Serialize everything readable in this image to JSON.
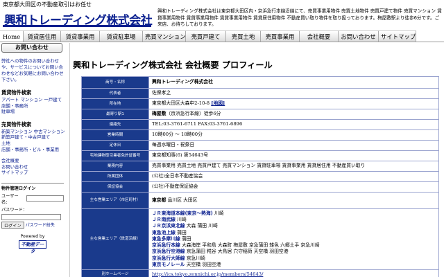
{
  "header": {
    "tagline": "東京都大田区の不動産取引はお任せ",
    "company_name": "興和トレーディング株式会社",
    "intro": "興和トレーディング株式会社は東京都大田区内・京浜急行本線沿線にて、売買事業用物件 売買土地物件 売買戸建て物件 売買マンション 賃貸事業用物件 賃貸事業用物件 賃貸事業用物件 賃貸居住用物件 不動産買い取り物件を取り扱っております。梅屋敷駅より徒歩6分です。ご来店、お待ちしております。"
  },
  "nav": {
    "items": [
      "Home",
      "賃貸居住用",
      "賃貸事業用",
      "賃貸駐車場",
      "売買マンション",
      "売買戸建て",
      "売買土地",
      "売買事業用",
      "会社概要",
      "お問い合わせ",
      "サイトマップ"
    ]
  },
  "sidebar": {
    "contact_title": "お問い合わせ",
    "contact_text": "弊社への物件のお問い合わせや、サービスについてお問い合わせなどお気軽にお問い合わせ下さい。",
    "rental_title": "賃貸物件検索",
    "rental_links": [
      "アパート マンション 一戸建て",
      "店舗・事務所",
      "駐車場"
    ],
    "sale_title": "売買物件検索",
    "sale_links": [
      "新築マンション 中古マンション",
      "新築戸建て・中古戸建て",
      "土地",
      "店舗・事務所・ビル・事業用"
    ],
    "misc_links": [
      "会社概要",
      "お問い合わせ",
      "サイトマップ"
    ],
    "login": {
      "title": "物件管理ログイン",
      "user_label": "ユーザー名：",
      "password_label": "パスワード：",
      "button": "ログイン",
      "forgot": "パスワード紛失"
    },
    "powered_by": "Powered by",
    "powered_logo": "不動産データ"
  },
  "main": {
    "title": "興和トレーディング株式会社 会社概要 プロフィール",
    "rows": {
      "name_label": "商号・名称",
      "name_value": "興和トレーディング株式会社",
      "rep_label": "代表者",
      "rep_value": "佐保孝之",
      "address_label": "所在地",
      "address_value": "東京都大田区大森中2-10-8",
      "address_map": "[地図]",
      "station_label": "最寄り駅1",
      "station_name": "梅屋敷",
      "station_rest": "（京浜急行本線）徒歩6分",
      "contact_label": "連絡先",
      "contact_value": "TEL:03-3761-6711 FAX:03-3761-6896",
      "hours_label": "営業時間",
      "hours_value": "10時00分 ～ 18時00分",
      "holiday_label": "定休日",
      "holiday_value": "毎週水曜日・祝祭日",
      "license_label": "宅地建物取引業者免許証番号",
      "license_value": "東京都知事(6) 第54643号",
      "business_label": "業務内容",
      "business_value": "売買事業用 売買土地 売買戸建て 売買マンション 賃貸駐車場 賃貸事業用 賃貸居住用 不動産買い取り",
      "assoc_label": "所属団体",
      "assoc_value": "(公社)全日本不動産協会",
      "guarantee_label": "保証協会",
      "guarantee_value": "(公社)不動産保証協会",
      "area_label": "主な営業エリア（市区町村）",
      "area_pref": "東京都",
      "area_value": "品川区 大田区",
      "lines_label": "主な営業エリア（鉄道沿線）",
      "lines": [
        {
          "line": "ＪＲ東海道本線(東京～熱海)",
          "stations": "川崎"
        },
        {
          "line": "ＪＲ南武線",
          "stations": "川崎"
        },
        {
          "line": "ＪＲ京浜東北線",
          "stations": "大森 蒲田 川崎"
        },
        {
          "line": "東急池上線",
          "stations": "蒲田"
        },
        {
          "line": "東急多摩川線",
          "stations": "蒲田"
        },
        {
          "line": "京浜急行本線",
          "stations": "大森海岸 平和島 大森町 梅屋敷 京急蒲田 雑色 六郷土手 京急川崎"
        },
        {
          "line": "京浜急行空港線",
          "stations": "京急蒲田 糀谷 大鳥居 穴守稲荷 天空橋 羽田空港"
        },
        {
          "line": "京浜急行大師線",
          "stations": "京急川崎"
        },
        {
          "line": "東京モノレール",
          "stations": "天空橋 羽田空港"
        }
      ],
      "homepage_label": "別ホームページ",
      "homepage_value": "http://ics.tokyo.zennichi.or.jp/members/54643/"
    }
  },
  "colors": {
    "brand_blue": "#0a1f8f",
    "label_bg": "#1a3a8c",
    "table_border": "#9aa3cf"
  }
}
